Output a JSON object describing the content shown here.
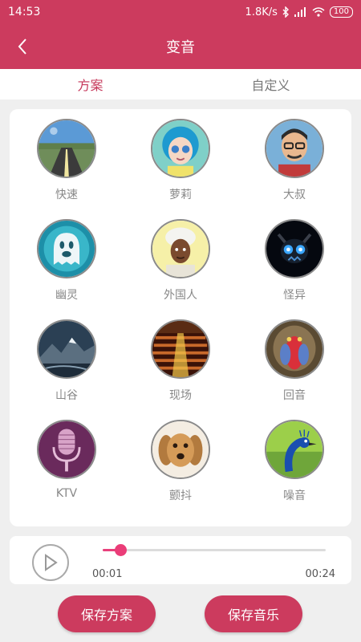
{
  "status": {
    "time": "14:53",
    "speed": "1.8K/s",
    "battery": "100"
  },
  "header": {
    "title": "变音"
  },
  "tabs": [
    {
      "label": "方案",
      "active": true
    },
    {
      "label": "自定义",
      "active": false
    }
  ],
  "effects": [
    {
      "label": "快速",
      "icon": "road-icon"
    },
    {
      "label": "萝莉",
      "icon": "girl-avatar-icon"
    },
    {
      "label": "大叔",
      "icon": "man-avatar-icon"
    },
    {
      "label": "幽灵",
      "icon": "ghost-icon"
    },
    {
      "label": "外国人",
      "icon": "foreigner-icon"
    },
    {
      "label": "怪异",
      "icon": "monster-icon"
    },
    {
      "label": "山谷",
      "icon": "valley-icon"
    },
    {
      "label": "现场",
      "icon": "crowd-icon"
    },
    {
      "label": "回音",
      "icon": "mandrill-icon"
    },
    {
      "label": "KTV",
      "icon": "microphone-icon"
    },
    {
      "label": "颤抖",
      "icon": "dog-icon"
    },
    {
      "label": "噪音",
      "icon": "peacock-icon"
    }
  ],
  "player": {
    "current": "00:01",
    "total": "00:24",
    "progress": 0.08
  },
  "buttons": {
    "save_plan": "保存方案",
    "save_music": "保存音乐"
  },
  "colors": {
    "primary": "#cc3b5e",
    "accent": "#ea3d78"
  }
}
